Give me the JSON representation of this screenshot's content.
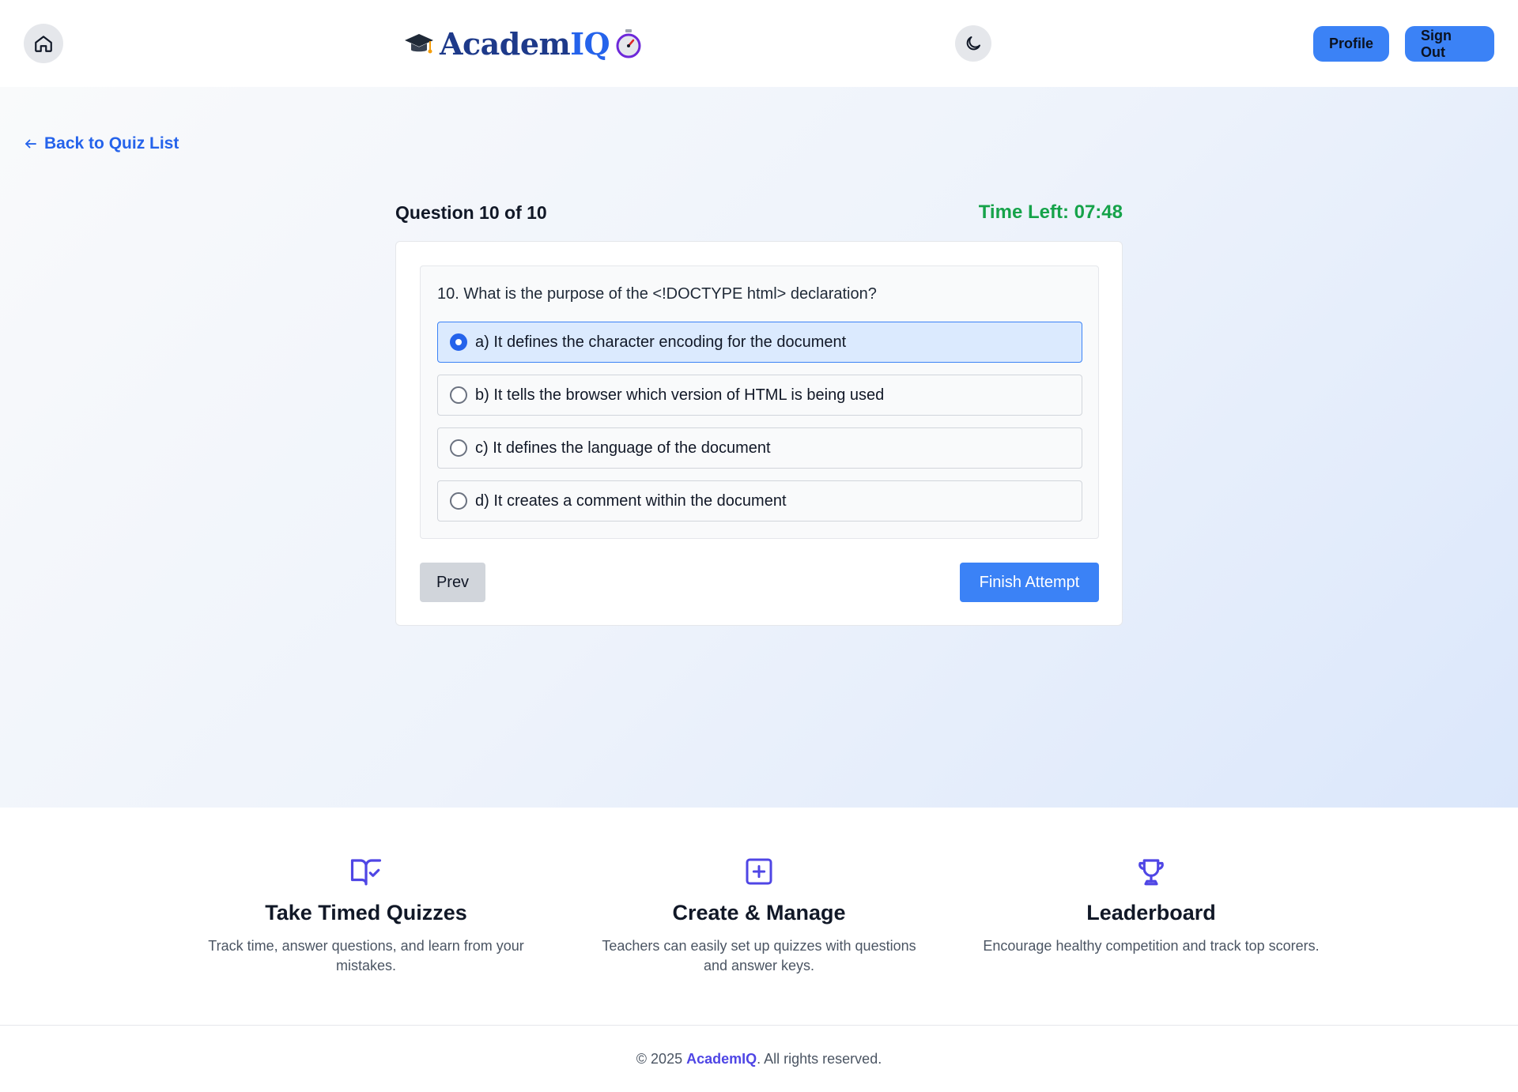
{
  "header": {
    "home_icon": "home-icon",
    "logo": {
      "cap_icon": "graduation-cap-icon",
      "brand_prefix": "Academ",
      "brand_suffix": "IQ",
      "stopwatch_icon": "stopwatch-icon"
    },
    "theme_icon": "moon-icon",
    "profile_label": "Profile",
    "signout_label": "Sign Out"
  },
  "main": {
    "back_link": "Back to Quiz List",
    "question_counter": "Question 10 of 10",
    "time_left": "Time Left: 07:48",
    "question": "10. What is the purpose of the <!DOCTYPE html> declaration?",
    "options": [
      {
        "label": "a) It defines the character encoding for the document",
        "selected": true
      },
      {
        "label": "b) It tells the browser which version of HTML is being used",
        "selected": false
      },
      {
        "label": "c) It defines the language of the document",
        "selected": false
      },
      {
        "label": "d) It creates a comment within the document",
        "selected": false
      }
    ],
    "prev_label": "Prev",
    "finish_label": "Finish Attempt"
  },
  "features": [
    {
      "icon": "book-check-icon",
      "title": "Take Timed Quizzes",
      "desc": "Track time, answer questions, and learn from your mistakes."
    },
    {
      "icon": "plus-square-icon",
      "title": "Create & Manage",
      "desc": "Teachers can easily set up quizzes with questions and answer keys."
    },
    {
      "icon": "trophy-icon",
      "title": "Leaderboard",
      "desc": "Encourage healthy competition and track top scorers."
    }
  ],
  "footer": {
    "prefix": "© 2025 ",
    "brand": "AcademIQ",
    "suffix": ". All rights reserved."
  },
  "colors": {
    "accent": "#3b82f6",
    "link": "#2563eb",
    "timer": "#16a34a",
    "brand_dark": "#1e3a8a",
    "feature_icon": "#4f46e5"
  }
}
